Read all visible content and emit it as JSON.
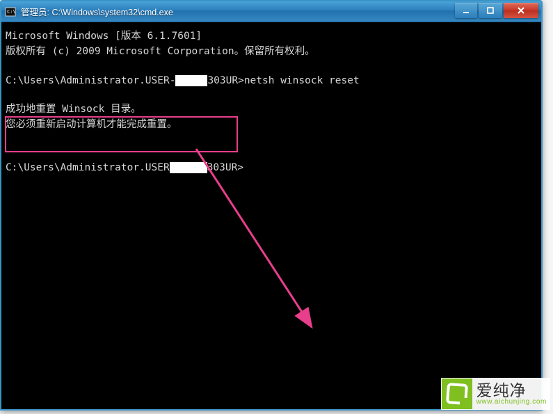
{
  "window": {
    "title": "管理员: C:\\Windows\\system32\\cmd.exe"
  },
  "terminal": {
    "line1": "Microsoft Windows [版本 6.1.7601]",
    "line2": "版权所有 (c) 2009 Microsoft Corporation。保留所有权利。",
    "prompt1_a": "C:\\Users\\Administrator.USER-",
    "prompt1_b": "303UR>",
    "command1": "netsh winsock reset",
    "result1": "成功地重置 Winsock 目录。",
    "result2": "您必须重新启动计算机才能完成重置。",
    "prompt2_a": "C:\\Users\\Administrator.USER",
    "prompt2_b": "303UR>"
  },
  "watermark": {
    "title": "爱纯净",
    "url": "www.aichunjing.com"
  },
  "colors": {
    "highlight": "#e83e8c",
    "titlebar": "#2b7ebb",
    "close": "#d83324",
    "brand": "#7fbf1f"
  }
}
